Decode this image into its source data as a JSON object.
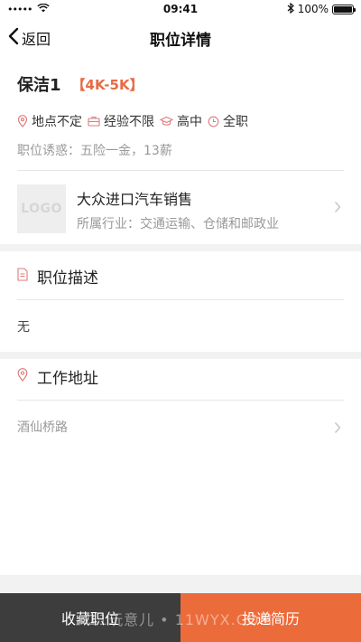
{
  "status_bar": {
    "signal": "•••••",
    "time": "09:41",
    "battery_text": "100%",
    "battery_level": 1.0
  },
  "nav": {
    "back_label": "返回",
    "title": "职位详情"
  },
  "job": {
    "title": "保洁1",
    "salary": "【4K-5K】",
    "tags": [
      {
        "icon": "location-pin-icon",
        "label": "地点不定"
      },
      {
        "icon": "briefcase-icon",
        "label": "经验不限"
      },
      {
        "icon": "graduation-cap-icon",
        "label": "高中"
      },
      {
        "icon": "clock-icon",
        "label": "全职"
      }
    ],
    "benefits": "职位诱惑：五险一金，13薪"
  },
  "company": {
    "logo_text": "LOGO",
    "name": "大众进口汽车销售",
    "industry": "所属行业：交通运输、仓储和邮政业"
  },
  "description": {
    "heading": "职位描述",
    "content": "无"
  },
  "address": {
    "heading": "工作地址",
    "content": "酒仙桥路"
  },
  "bottom": {
    "favorite_label": "收藏职位",
    "apply_label": "投递简历",
    "watermark": "11玩意儿 • 11WYX.COM"
  },
  "colors": {
    "accent": "#ec6b3a",
    "salary": "#e86a45",
    "icon": "#e07a7a",
    "dark_button": "#3d3d3d"
  }
}
